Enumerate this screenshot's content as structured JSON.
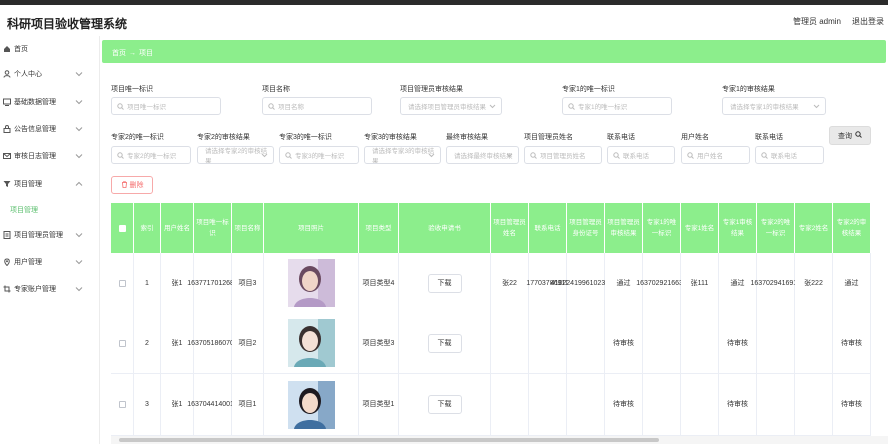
{
  "header": {
    "title": "科研项目验收管理系统",
    "admin": "管理员 admin",
    "logout": "退出登录"
  },
  "sidebar": {
    "items": [
      {
        "label": "首页",
        "icon": "home-icon"
      },
      {
        "label": "个人中心",
        "icon": "user-icon"
      },
      {
        "label": "基础数据管理",
        "icon": "monitor-icon"
      },
      {
        "label": "公告信息管理",
        "icon": "lock-icon"
      },
      {
        "label": "审核日志管理",
        "icon": "mail-icon"
      },
      {
        "label": "项目管理",
        "icon": "filter-icon"
      },
      {
        "label": "项目管理员管理",
        "icon": "document-icon"
      },
      {
        "label": "用户管理",
        "icon": "location-icon"
      },
      {
        "label": "专家账户管理",
        "icon": "crop-icon"
      }
    ],
    "active_sub": "项目管理"
  },
  "breadcrumb": {
    "home": "首页",
    "sep": "→",
    "current": "项目"
  },
  "filters": {
    "f1": {
      "label": "项目唯一标识",
      "placeholder": "项目唯一标识"
    },
    "f2": {
      "label": "项目名称",
      "placeholder": "项目名称"
    },
    "f3": {
      "label": "项目管理员审核结果",
      "placeholder": "请选择项目管理员审核结果"
    },
    "f4": {
      "label": "专家1的唯一标识",
      "placeholder": "专家1的唯一标识"
    },
    "f5": {
      "label": "专家1的审核结果",
      "placeholder": "请选择专家1的审核结果"
    },
    "f6": {
      "label": "专家2的唯一标识",
      "placeholder": "专家2的唯一标识"
    },
    "f7": {
      "label": "专家2的审核结果",
      "placeholder": "请选择专家2的审核结果"
    },
    "f8": {
      "label": "专家3的唯一标识",
      "placeholder": "专家3的唯一标识"
    },
    "f9": {
      "label": "专家3的审核结果",
      "placeholder": "请选择专家3的审核结果"
    },
    "f10": {
      "label": "最终审核结果",
      "placeholder": "请选择最终审核结果"
    },
    "f11": {
      "label": "项目管理员姓名",
      "placeholder": "项目管理员姓名"
    },
    "f12": {
      "label": "联系电话",
      "placeholder": "联系电话"
    },
    "f13": {
      "label": "用户姓名",
      "placeholder": "用户姓名"
    },
    "f14": {
      "label": "联系电话",
      "placeholder": "联系电话"
    }
  },
  "buttons": {
    "search": "查询",
    "delete": "删除",
    "download": "下载"
  },
  "table": {
    "headers": [
      "",
      "索引",
      "用户姓名",
      "项目唯一标识",
      "项目名称",
      "项目照片",
      "项目类型",
      "验收申请书",
      "项目管理员姓名",
      "联系电话",
      "项目管理员身份证号",
      "项目管理员审核结果",
      "专家1的唯一标识",
      "专家1姓名",
      "专家1审核结果",
      "专家2的唯一标识",
      "专家2姓名",
      "专家2的审核结果"
    ],
    "rows": [
      [
        "",
        "1",
        "张1",
        "1637717012688",
        "项目3",
        "",
        "项目类型4",
        "",
        "张22",
        "17703786911",
        "410224199610232011",
        "通过",
        "1637029216630",
        "张111",
        "通过",
        "1637029416911",
        "张222",
        "通过"
      ],
      [
        "",
        "2",
        "张1",
        "1637051860708",
        "项目2",
        "",
        "项目类型3",
        "",
        "",
        "",
        "",
        "待审核",
        "",
        "",
        "待审核",
        "",
        "",
        "待审核"
      ],
      [
        "",
        "3",
        "张1",
        "1637044140014",
        "项目1",
        "",
        "项目类型1",
        "",
        "",
        "",
        "",
        "待审核",
        "",
        "",
        "待审核",
        "",
        "",
        "待审核"
      ]
    ]
  },
  "colors": {
    "accent": "#8cee8c",
    "active": "#5bbf6e",
    "danger": "#f56c6c"
  }
}
